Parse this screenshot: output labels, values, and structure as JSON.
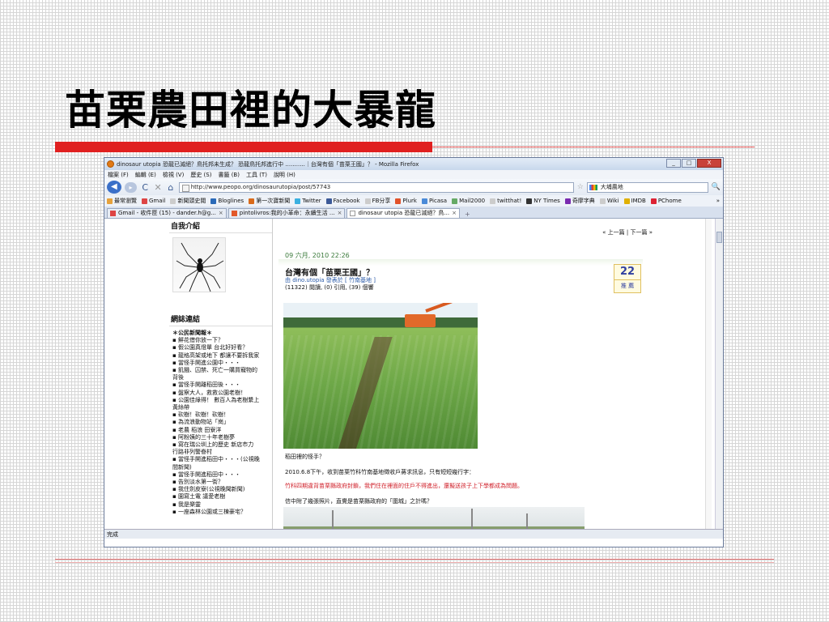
{
  "slide": {
    "title": "苗栗農田裡的大暴龍"
  },
  "window": {
    "title": "dinosaur utopia 恐龍已滅絕？鳥托邦未生成？ 恐龍鳥托邦進行中 ...........｜台灣有個「苗栗王國」？ - Mozilla Firefox",
    "minimize_label": "_",
    "maximize_label": "□",
    "close_label": "X"
  },
  "menu": {
    "items": [
      "檔案 (F)",
      "編輯 (E)",
      "檢視 (V)",
      "歷史 (S)",
      "書籤 (B)",
      "工具 (T)",
      "說明 (H)"
    ]
  },
  "navbar": {
    "back": "◀",
    "forward": "▸",
    "reload": "C",
    "stop": "✕",
    "home": "⌂",
    "url": "http://www.peopo.org/dinosaurutopia/post/57743",
    "search_value": "大埔農地",
    "search_go": "🔍"
  },
  "bookmarks": {
    "items": [
      "最常瀏覽",
      "Gmail",
      "新聞頭史閱",
      "Bloglines",
      "第一次寶新聞",
      "Twitter",
      "Facebook",
      "FB分享",
      "Plurk",
      "Picasa",
      "Mail2000",
      "twitthat!",
      "NY Times",
      "奇摩字典",
      "Wiki",
      "IMDB",
      "PChome"
    ],
    "colors": [
      "#e6a23c",
      "#d44",
      "#ccc",
      "#2a6ab8",
      "#d96a1a",
      "#3ab0e0",
      "#3b5998",
      "#ccc",
      "#e2522a",
      "#4a8ad8",
      "#6a6",
      "#ccc",
      "#333",
      "#7a2ab0",
      "#ccc",
      "#e0b000",
      "#d23"
    ],
    "overflow": "»"
  },
  "tabs": [
    {
      "label": "Gmail - 收件匣 (15) - dander.h@g...",
      "close": "×"
    },
    {
      "label": "pintolivros:我的小革命：永續生活 ...",
      "close": "×"
    },
    {
      "label": "dinosaur utopia 恐龍已滅絕？鳥...",
      "close": "×"
    }
  ],
  "tab_new": "+",
  "sidebar": {
    "intro_heading": "自我介紹",
    "links_heading": "網誌連結",
    "links_title": "＊公民新聞報＊",
    "links": [
      "▪ 鮮花借你放一下？",
      "▪ 假公園真燈單 台北好好看？",
      "▪ 龍格高架或地下 都讓不要拆我家",
      "▪ 當怪手開進公園中・・・",
      "▪ 飢餓、囚禁、死亡一購買寵物的",
      "背後",
      "▪ 當怪手開離稻田後・・・",
      "▪ 盤察大人，救救公園老樹！",
      "▪ 公園佳綠得！ 數百人為老樹繫上",
      "黃絲帶",
      "▪ 砍樹！砍樹！砍樹！",
      "▪ 為流浪動物站「崗」",
      "▪ 老農 稻浪 田寮洋",
      "▪ 阿粉姨的三十年老樹夢",
      "▪ 寫在瑞公圳上的歷史 新店市力",
      "行路非列警眷村",
      "▪ 當怪手開進稻田中・・・(公視晚",
      "間新聞)",
      "▪ 當怪手開進稻田中・・・",
      "▪ 告別淡水第一街？",
      "▪ 我住劍皮寮(公視晚聞新聞)",
      "▪ 園寫土電 議愛老樹",
      "▪ 我是樂靈",
      "▪ 一座森林公園或三棟豪宅？"
    ]
  },
  "post": {
    "nav": "« 上一篇 | 下一篇 »",
    "date": "09 六月, 2010 22:26",
    "title": "台灣有個「苗栗王國」？",
    "meta": "由 dino.utopia 發表於 [ 竹南基地 ]",
    "stats": "(11322) 閱讀, (0) 引用, (39) 個響",
    "digg_count": "22",
    "digg_label": "推 薦",
    "caption": "稻田裡的怪手？",
    "paragraph1": "2010.6.8下午，收到苗栗竹科竹南基地徵收戶蔣求訊息，只有短短幾行字：",
    "paragraph_red": "竹科四期違背苗栗縣政府封鎖，我們住在裡面的住戶不得進出，還擬送孩子上下學都成為問題。",
    "paragraph2": "信中附了幾張照片，直覺是苗栗縣政府的「圍城」之計嗎？"
  },
  "status": {
    "text": "完成"
  }
}
